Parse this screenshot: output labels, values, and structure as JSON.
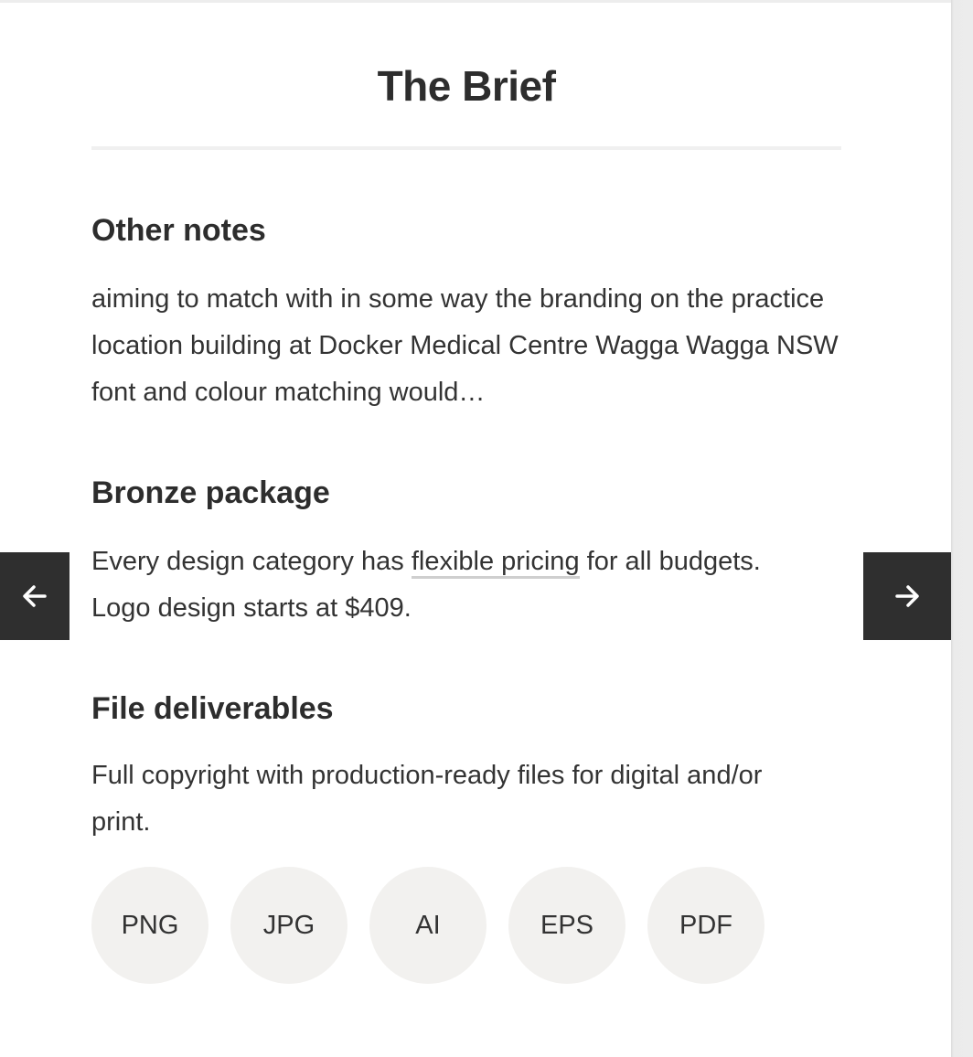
{
  "brief": {
    "title": "The Brief",
    "sections": [
      {
        "heading": "Other notes",
        "body": "aiming to match with in some way the branding on the practice location building at Docker Medical Centre Wagga Wagga NSW font and colour matching would…"
      },
      {
        "heading": "Bronze package",
        "body_before": "Every design category has ",
        "link": "flexible pricing",
        "body_after": " for all budgets. Logo design starts at $409."
      },
      {
        "heading": "File deliverables",
        "body": "Full copyright with production-ready files for digital and/or print."
      }
    ],
    "formats": [
      "PNG",
      "JPG",
      "AI",
      "EPS",
      "PDF"
    ]
  },
  "nav": {
    "prev_icon": "arrow-left-icon",
    "next_icon": "arrow-right-icon"
  },
  "colors": {
    "text": "#2f2f2f",
    "nav_button": "#2f2f2f",
    "chip": "#f2f1ef",
    "divider": "#f0f0f0"
  }
}
